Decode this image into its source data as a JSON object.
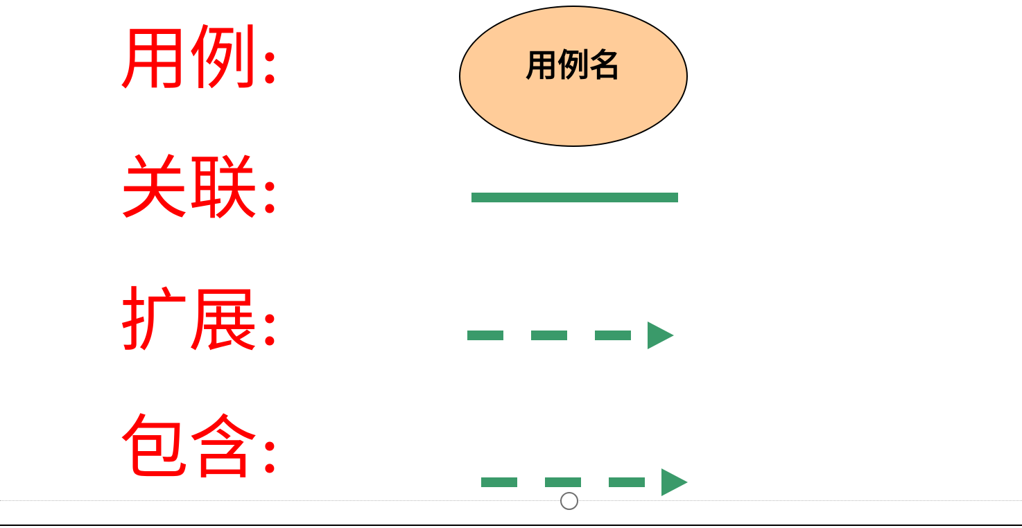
{
  "legend": {
    "rows": [
      {
        "key": "usecase",
        "label": "用例:"
      },
      {
        "key": "association",
        "label": "关联:"
      },
      {
        "key": "extend",
        "label": "扩展:"
      },
      {
        "key": "include",
        "label": "包含:"
      }
    ],
    "usecase_name": "用例名"
  },
  "colors": {
    "label_text": "#ff0000",
    "usecase_fill": "#ffcc99",
    "usecase_border": "#000000",
    "connector": "#3a9a6a"
  },
  "icons": {
    "association": "solid-line",
    "extend": "dashed-arrow",
    "include": "dashed-arrow"
  }
}
